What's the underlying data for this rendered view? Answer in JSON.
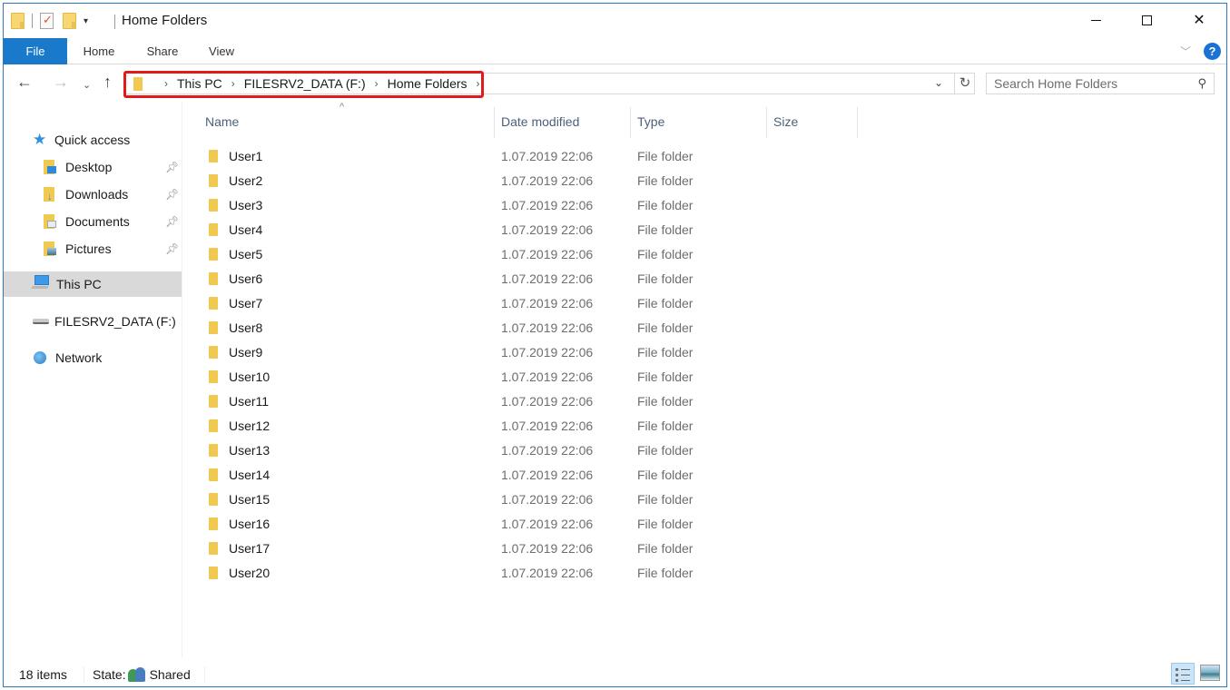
{
  "window": {
    "title": "Home Folders",
    "controls": {
      "minimize": "minimize",
      "maximize": "maximize",
      "close": "close"
    }
  },
  "quick_access_toolbar": {
    "icons": [
      "folder-icon",
      "properties-icon",
      "new-folder-icon",
      "customize-dropdown-icon"
    ]
  },
  "ribbon": {
    "tabs": [
      {
        "label": "File",
        "active": true
      },
      {
        "label": "Home"
      },
      {
        "label": "Share"
      },
      {
        "label": "View"
      }
    ],
    "help_label": "?"
  },
  "navigation": {
    "back": "←",
    "forward": "→",
    "recent": "⌄",
    "up": "↑"
  },
  "address_bar": {
    "breadcrumbs": [
      "This PC",
      "FILESRV2_DATA (F:)",
      "Home Folders"
    ],
    "highlight_color": "#e01b1b"
  },
  "search": {
    "placeholder": "Search Home Folders",
    "value": ""
  },
  "nav_pane": {
    "quick_access": {
      "label": "Quick access",
      "items": [
        {
          "label": "Desktop",
          "pinned": true
        },
        {
          "label": "Downloads",
          "pinned": true
        },
        {
          "label": "Documents",
          "pinned": true
        },
        {
          "label": "Pictures",
          "pinned": true
        }
      ]
    },
    "this_pc": {
      "label": "This PC",
      "selected": true
    },
    "drive": {
      "label": "FILESRV2_DATA (F:)"
    },
    "network": {
      "label": "Network"
    }
  },
  "file_list": {
    "columns": [
      "Name",
      "Date modified",
      "Type",
      "Size"
    ],
    "sort_column": "Name",
    "rows": [
      {
        "name": "User1",
        "date": "1.07.2019 22:06",
        "type": "File folder",
        "size": ""
      },
      {
        "name": "User2",
        "date": "1.07.2019 22:06",
        "type": "File folder",
        "size": ""
      },
      {
        "name": "User3",
        "date": "1.07.2019 22:06",
        "type": "File folder",
        "size": ""
      },
      {
        "name": "User4",
        "date": "1.07.2019 22:06",
        "type": "File folder",
        "size": ""
      },
      {
        "name": "User5",
        "date": "1.07.2019 22:06",
        "type": "File folder",
        "size": ""
      },
      {
        "name": "User6",
        "date": "1.07.2019 22:06",
        "type": "File folder",
        "size": ""
      },
      {
        "name": "User7",
        "date": "1.07.2019 22:06",
        "type": "File folder",
        "size": ""
      },
      {
        "name": "User8",
        "date": "1.07.2019 22:06",
        "type": "File folder",
        "size": ""
      },
      {
        "name": "User9",
        "date": "1.07.2019 22:06",
        "type": "File folder",
        "size": ""
      },
      {
        "name": "User10",
        "date": "1.07.2019 22:06",
        "type": "File folder",
        "size": ""
      },
      {
        "name": "User11",
        "date": "1.07.2019 22:06",
        "type": "File folder",
        "size": ""
      },
      {
        "name": "User12",
        "date": "1.07.2019 22:06",
        "type": "File folder",
        "size": ""
      },
      {
        "name": "User13",
        "date": "1.07.2019 22:06",
        "type": "File folder",
        "size": ""
      },
      {
        "name": "User14",
        "date": "1.07.2019 22:06",
        "type": "File folder",
        "size": ""
      },
      {
        "name": "User15",
        "date": "1.07.2019 22:06",
        "type": "File folder",
        "size": ""
      },
      {
        "name": "User16",
        "date": "1.07.2019 22:06",
        "type": "File folder",
        "size": ""
      },
      {
        "name": "User17",
        "date": "1.07.2019 22:06",
        "type": "File folder",
        "size": ""
      },
      {
        "name": "User20",
        "date": "1.07.2019 22:06",
        "type": "File folder",
        "size": ""
      }
    ]
  },
  "status_bar": {
    "item_count": "18 items",
    "state_label": "State:",
    "state_value": "Shared",
    "views": [
      "details-view",
      "large-icons-view"
    ],
    "active_view": "details-view"
  }
}
